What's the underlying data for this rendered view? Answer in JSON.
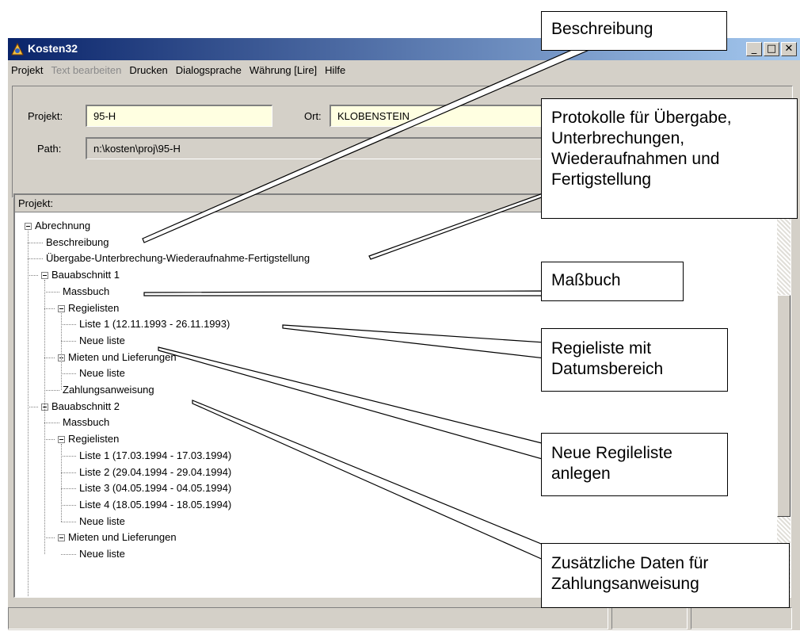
{
  "window": {
    "title": "Kosten32",
    "buttons": {
      "minimize": "_",
      "maximize": "□",
      "close": "✕"
    }
  },
  "menu": [
    {
      "label": "Projekt",
      "disabled": false
    },
    {
      "label": "Text bearbeiten",
      "disabled": true
    },
    {
      "label": "Drucken",
      "disabled": false
    },
    {
      "label": "Dialogsprache",
      "disabled": false
    },
    {
      "label": "Währung [Lire]",
      "disabled": false
    },
    {
      "label": "Hilfe",
      "disabled": false
    }
  ],
  "fields": {
    "projekt_label": "Projekt:",
    "projekt_value": "95-H",
    "ort_label": "Ort:",
    "ort_value": "KLOBENSTEIN",
    "path_label": "Path:",
    "path_value": "n:\\kosten\\proj\\95-H"
  },
  "tree": {
    "header": "Projekt:",
    "nodes": [
      "Abrechnung",
      "Beschreibung",
      "Übergabe-Unterbrechung-Wiederaufnahme-Fertigstellung",
      "Bauabschnitt 1",
      "Massbuch",
      "Regielisten",
      "Liste 1 (12.11.1993 - 26.11.1993)",
      "Neue liste",
      "Mieten und Lieferungen",
      "Neue liste",
      "Zahlungsanweisung",
      "Bauabschnitt 2",
      "Massbuch",
      "Regielisten",
      "Liste 1 (17.03.1994 - 17.03.1994)",
      "Liste 2 (29.04.1994 - 29.04.1994)",
      "Liste 3 (04.05.1994 - 04.05.1994)",
      "Liste 4 (18.05.1994 - 18.05.1994)",
      "Neue liste",
      "Mieten und Lieferungen",
      "Neue liste"
    ]
  },
  "callouts": {
    "beschreibung": "Beschreibung",
    "protokolle": "Protokolle für Übergabe, Unterbrechungen, Wiederaufnahmen und Fertigstellung",
    "massbuch": "Maßbuch",
    "regieliste": "Regieliste mit Datumsbereich",
    "neue_regieliste": "Neue Regileliste anlegen",
    "zahlung": "Zusätzliche Daten für Zahlungsanweisung"
  }
}
